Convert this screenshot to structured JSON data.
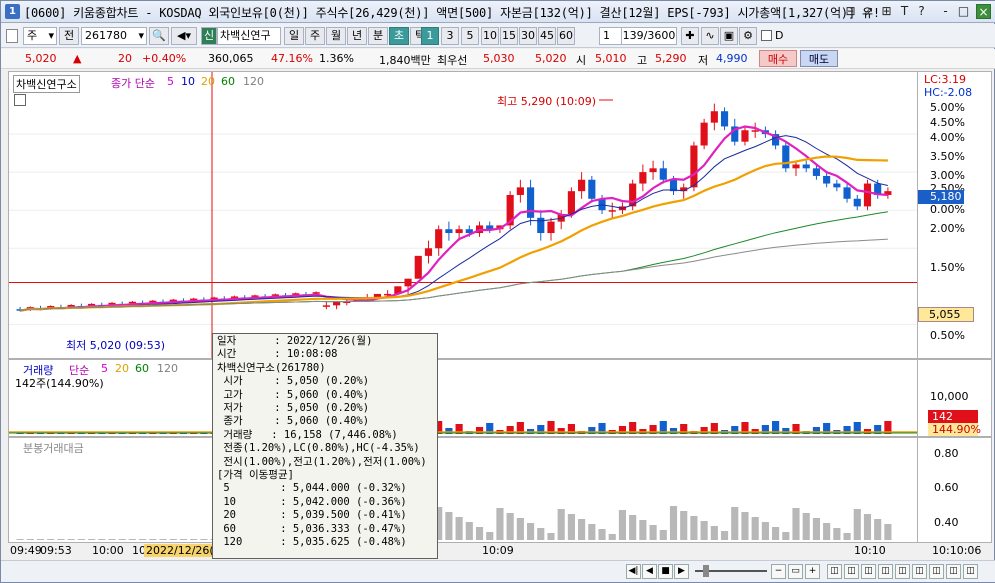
{
  "window": {
    "title": "[0600] 키움종합차트 - KOSDAQ 외국인보유[0(천)] 주식수[26,429(천)] 액면[500] 자본금[132(억)] 결산[12월] EPS[-793] 시가총액[1,327(억)] 유!",
    "app_icon_label": "1",
    "controls": [
      "⊟",
      "⇗",
      "⊞",
      "T",
      "?",
      "-",
      "□",
      "×"
    ]
  },
  "toolbar": {
    "period_select": "주",
    "prev_btn": "전",
    "code_value": "261780",
    "search_icon": "search-icon",
    "sound_icon": "speaker-icon",
    "credit_badge": "신",
    "stock_name": "차백신연구",
    "period_tabs": [
      "일",
      "주",
      "월",
      "년",
      "분",
      "초",
      "틱"
    ],
    "selected_period": "초",
    "interval_buttons": [
      "1",
      "3",
      "5",
      "10",
      "15",
      "30",
      "45",
      "60"
    ],
    "selected_interval": "1",
    "interval_select": "1",
    "count_display": "139/3600",
    "checkbox_label": "D"
  },
  "quote": {
    "price": "5,020",
    "change_arrow": "▲",
    "change": "20",
    "change_rate": "+0.40%",
    "volume": "360,065",
    "ratio": "47.16%",
    "turnover": "1.36%",
    "amount": "1,840백만",
    "best_ask_label": "최우선",
    "best_ask": "5,030",
    "best_bid": "5,020",
    "open_label": "시",
    "open": "5,010",
    "high_label": "고",
    "high": "5,290",
    "low_label": "저",
    "low": "4,990",
    "buy_btn": "매수",
    "sell_btn": "매도"
  },
  "price_panel": {
    "stock_label": "차백신연구소",
    "legend": [
      {
        "text": "종가 단순",
        "color": "#b000b0"
      },
      {
        "text": "5",
        "color": "#d000d0"
      },
      {
        "text": "10",
        "color": "#0000c0"
      },
      {
        "text": "20",
        "color": "#e0a000"
      },
      {
        "text": "60",
        "color": "#008000"
      },
      {
        "text": "120",
        "color": "#808080"
      }
    ],
    "high_annotation": "최고 5,290 (10:09)",
    "low_annotation": "최저 5,020 (09:53)",
    "lc": "LC:3.19",
    "hc": "HC:-2.08",
    "y_labels": [
      "5.00%",
      "4.50%",
      "4.00%",
      "3.50%",
      "3.00%",
      "2.50%",
      "0.00%",
      "2.00%",
      "1.50%",
      "0.50%"
    ],
    "current_price_tag": "5,180",
    "crosshair_price_tag": "5,055"
  },
  "volume_panel": {
    "title": "거래량",
    "legend": [
      {
        "text": "단순",
        "color": "#b000b0"
      },
      {
        "text": "5",
        "color": "#d000d0"
      },
      {
        "text": "20",
        "color": "#e0a000"
      },
      {
        "text": "60",
        "color": "#008000"
      },
      {
        "text": "120",
        "color": "#808080"
      }
    ],
    "subtitle": "142주(144.90%)",
    "y_label": "10,000",
    "tag_value": "142",
    "tag_pct": "144.90%"
  },
  "amount_panel": {
    "title": "분봉거래대금",
    "y_labels": [
      "0.80",
      "0.60",
      "0.40"
    ]
  },
  "tooltip": {
    "lines": [
      "일자      : 2022/12/26(월)",
      "시간      : 10:08:08",
      "차백신연구소(261780)",
      " 시가     : 5,050 (0.20%)",
      " 고가     : 5,060 (0.40%)",
      " 저가     : 5,050 (0.20%)",
      " 종가     : 5,060 (0.40%)",
      " 거래량   : 16,158 (7,446.08%)",
      " 전종(1.20%),LC(0.80%),HC(-4.35%)",
      " 전시(1.00%),전고(1.20%),전저(1.00%)",
      "[가격 이동평균]",
      " 5        : 5,044.000 (-0.32%)",
      " 10       : 5,042.000 (-0.36%)",
      " 20       : 5,039.500 (-0.41%)",
      " 60       : 5,036.333 (-0.47%)",
      " 120      : 5,035.625 (-0.48%)"
    ]
  },
  "x_axis": {
    "labels": [
      "09:49",
      "09:53",
      "10:00",
      "10",
      "2022/12/26(",
      "10:09",
      "10:10",
      "10:10:06"
    ]
  },
  "chart_data": {
    "type": "candlestick",
    "title": "차백신연구소",
    "candles": [
      {
        "o": 5025,
        "h": 5030,
        "l": 5020,
        "c": 5025
      },
      {
        "o": 5025,
        "h": 5030,
        "l": 5020,
        "c": 5030
      },
      {
        "o": 5030,
        "h": 5035,
        "l": 5025,
        "c": 5030
      },
      {
        "o": 5030,
        "h": 5035,
        "l": 5030,
        "c": 5035
      },
      {
        "o": 5035,
        "h": 5040,
        "l": 5030,
        "c": 5035
      },
      {
        "o": 5035,
        "h": 5040,
        "l": 5035,
        "c": 5040
      },
      {
        "o": 5040,
        "h": 5045,
        "l": 5035,
        "c": 5040
      },
      {
        "o": 5040,
        "h": 5050,
        "l": 5040,
        "c": 5050
      },
      {
        "o": 5050,
        "h": 5060,
        "l": 5040,
        "c": 5060
      },
      {
        "o": 5060,
        "h": 5090,
        "l": 5060,
        "c": 5090
      },
      {
        "o": 5090,
        "h": 5110,
        "l": 5080,
        "c": 5100
      },
      {
        "o": 5100,
        "h": 5130,
        "l": 5090,
        "c": 5125
      },
      {
        "o": 5125,
        "h": 5135,
        "l": 5110,
        "c": 5120
      },
      {
        "o": 5120,
        "h": 5130,
        "l": 5110,
        "c": 5125
      },
      {
        "o": 5125,
        "h": 5130,
        "l": 5115,
        "c": 5120
      },
      {
        "o": 5120,
        "h": 5135,
        "l": 5115,
        "c": 5130
      },
      {
        "o": 5130,
        "h": 5135,
        "l": 5120,
        "c": 5125
      },
      {
        "o": 5125,
        "h": 5130,
        "l": 5120,
        "c": 5130
      },
      {
        "o": 5130,
        "h": 5175,
        "l": 5125,
        "c": 5170
      },
      {
        "o": 5170,
        "h": 5190,
        "l": 5160,
        "c": 5180
      },
      {
        "o": 5180,
        "h": 5190,
        "l": 5130,
        "c": 5140
      },
      {
        "o": 5140,
        "h": 5150,
        "l": 5110,
        "c": 5120
      },
      {
        "o": 5120,
        "h": 5140,
        "l": 5110,
        "c": 5135
      },
      {
        "o": 5135,
        "h": 5150,
        "l": 5125,
        "c": 5145
      },
      {
        "o": 5145,
        "h": 5180,
        "l": 5140,
        "c": 5175
      },
      {
        "o": 5175,
        "h": 5200,
        "l": 5165,
        "c": 5190
      },
      {
        "o": 5190,
        "h": 5195,
        "l": 5160,
        "c": 5165
      },
      {
        "o": 5165,
        "h": 5170,
        "l": 5145,
        "c": 5150
      },
      {
        "o": 5150,
        "h": 5160,
        "l": 5140,
        "c": 5150
      },
      {
        "o": 5150,
        "h": 5160,
        "l": 5145,
        "c": 5155
      },
      {
        "o": 5155,
        "h": 5190,
        "l": 5150,
        "c": 5185
      },
      {
        "o": 5185,
        "h": 5210,
        "l": 5175,
        "c": 5200
      },
      {
        "o": 5200,
        "h": 5215,
        "l": 5190,
        "c": 5205
      },
      {
        "o": 5205,
        "h": 5215,
        "l": 5185,
        "c": 5190
      },
      {
        "o": 5190,
        "h": 5195,
        "l": 5170,
        "c": 5175
      },
      {
        "o": 5175,
        "h": 5185,
        "l": 5165,
        "c": 5180
      },
      {
        "o": 5180,
        "h": 5240,
        "l": 5175,
        "c": 5235
      },
      {
        "o": 5235,
        "h": 5270,
        "l": 5230,
        "c": 5265
      },
      {
        "o": 5265,
        "h": 5290,
        "l": 5255,
        "c": 5280
      },
      {
        "o": 5280,
        "h": 5285,
        "l": 5255,
        "c": 5260
      },
      {
        "o": 5260,
        "h": 5270,
        "l": 5235,
        "c": 5240
      },
      {
        "o": 5240,
        "h": 5260,
        "l": 5235,
        "c": 5255
      },
      {
        "o": 5255,
        "h": 5265,
        "l": 5245,
        "c": 5255
      },
      {
        "o": 5255,
        "h": 5260,
        "l": 5245,
        "c": 5250
      },
      {
        "o": 5250,
        "h": 5255,
        "l": 5230,
        "c": 5235
      },
      {
        "o": 5235,
        "h": 5240,
        "l": 5200,
        "c": 5205
      },
      {
        "o": 5205,
        "h": 5215,
        "l": 5195,
        "c": 5210
      },
      {
        "o": 5210,
        "h": 5215,
        "l": 5200,
        "c": 5205
      },
      {
        "o": 5205,
        "h": 5210,
        "l": 5190,
        "c": 5195
      },
      {
        "o": 5195,
        "h": 5200,
        "l": 5180,
        "c": 5185
      },
      {
        "o": 5185,
        "h": 5190,
        "l": 5175,
        "c": 5180
      },
      {
        "o": 5180,
        "h": 5185,
        "l": 5160,
        "c": 5165
      },
      {
        "o": 5165,
        "h": 5170,
        "l": 5150,
        "c": 5155
      },
      {
        "o": 5155,
        "h": 5190,
        "l": 5150,
        "c": 5185
      },
      {
        "o": 5185,
        "h": 5190,
        "l": 5165,
        "c": 5170
      },
      {
        "o": 5170,
        "h": 5180,
        "l": 5165,
        "c": 5175
      }
    ],
    "y_range": [
      4990,
      5300
    ]
  },
  "colors": {
    "up": "#e0101a",
    "down": "#1060d0",
    "ma5": "#e020c0",
    "ma10": "#1a2aa0",
    "ma20": "#f0a000",
    "ma60": "#1a8a2a",
    "ma120": "#8a8a8a",
    "accent": "#3b9a9a"
  }
}
